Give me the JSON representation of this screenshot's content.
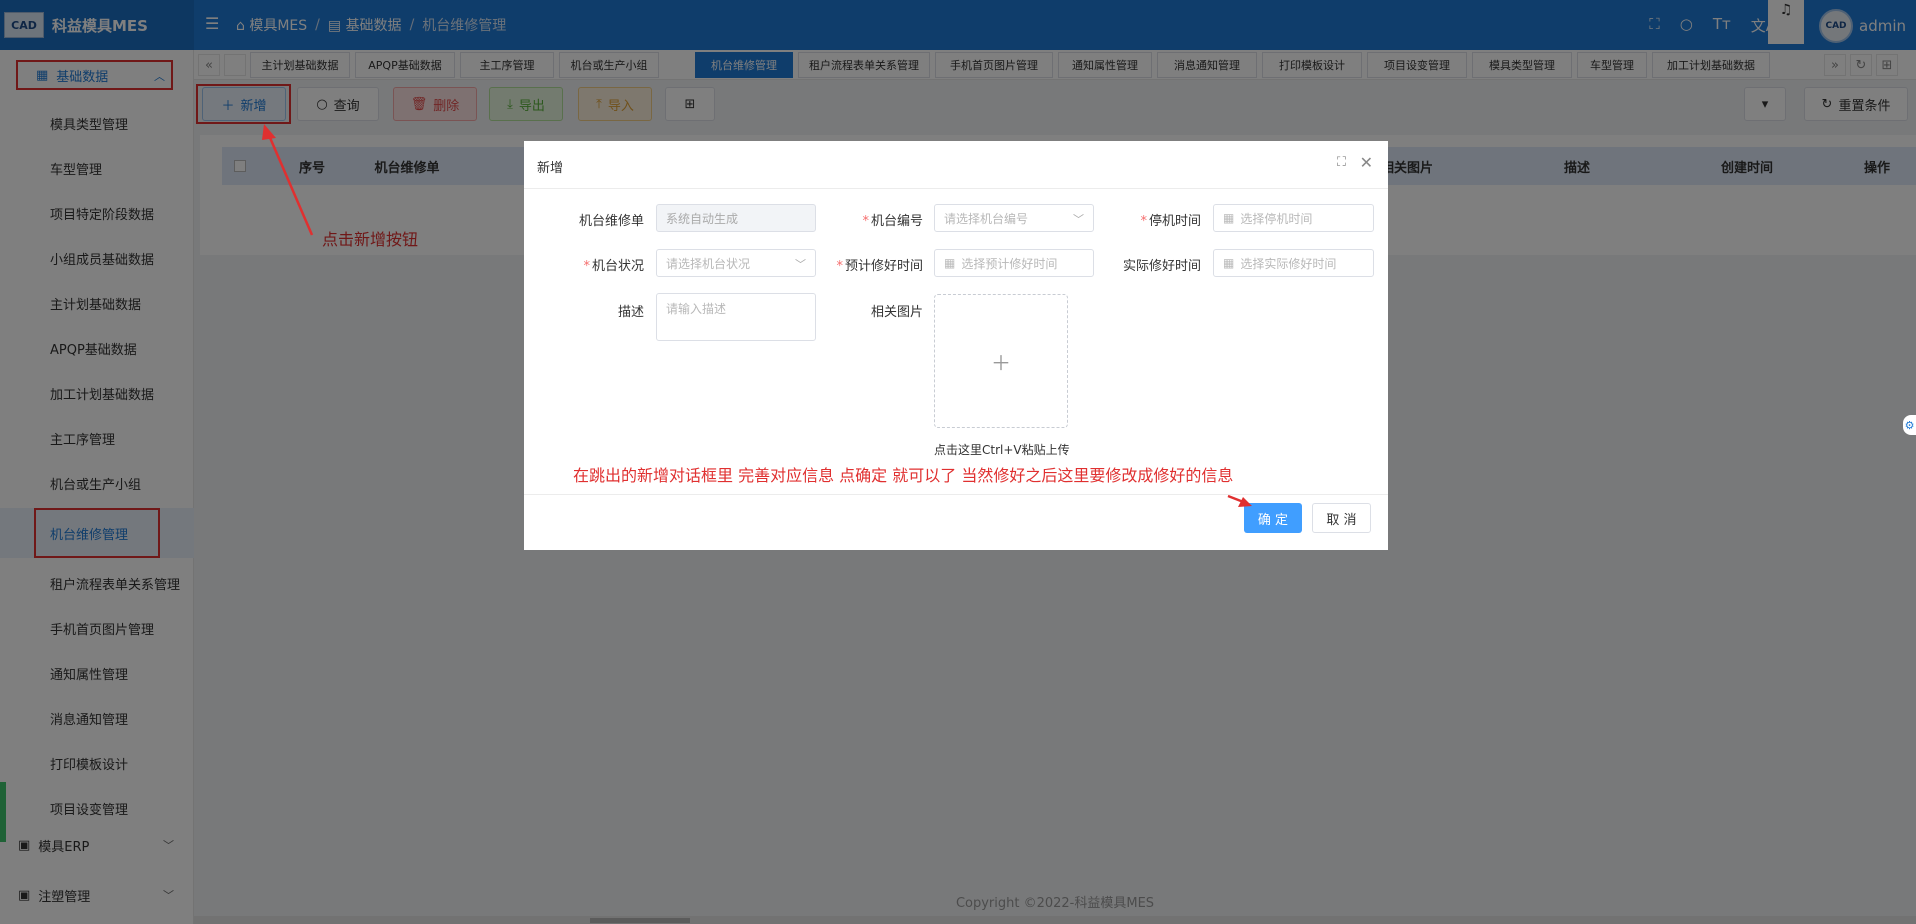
{
  "app": {
    "title": "科益模具MES",
    "logo_text": "CAD"
  },
  "header": {
    "breadcrumb": [
      "模具MES",
      "基础数据",
      "机台维修管理"
    ],
    "icons": [
      "fullscreen-icon",
      "search-icon",
      "font-size-icon",
      "translate-icon",
      "bell-icon"
    ],
    "user": "admin",
    "colors": {
      "bar": "#1f7ad6",
      "logo_bg": "#1b6fc3"
    }
  },
  "sidebar": {
    "group": "基础数据",
    "items": [
      "模具类型管理",
      "车型管理",
      "项目特定阶段数据",
      "小组成员基础数据",
      "主计划基础数据",
      "APQP基础数据",
      "加工计划基础数据",
      "主工序管理",
      "机台或生产小组",
      "机台维修管理",
      "租户流程表单关系管理",
      "手机首页图片管理",
      "通知属性管理",
      "消息通知管理",
      "打印模板设计",
      "项目设变管理"
    ],
    "active": "机台维修管理",
    "bottom": [
      "模具ERP",
      "注塑管理"
    ]
  },
  "tabs": [
    "主计划基础数据",
    "APQP基础数据",
    "主工序管理",
    "机台或生产小组",
    "机台维修管理",
    "租户流程表单关系管理",
    "手机首页图片管理",
    "通知属性管理",
    "消息通知管理",
    "打印模板设计",
    "项目设变管理",
    "模具类型管理",
    "车型管理",
    "加工计划基础数据"
  ],
  "tabs_active": "机台维修管理",
  "toolbar": {
    "add": "新增",
    "query": "查询",
    "delete": "删除",
    "export": "导出",
    "import": "导入",
    "reset": "重置条件"
  },
  "table": {
    "headers": [
      "序号",
      "机台维修单",
      "相关图片",
      "描述",
      "创建时间",
      "操作"
    ]
  },
  "annotations": {
    "click_add": "点击新增按钮",
    "modal_hint": "在跳出的新增对话框里 完善对应信息 点确定 就可以了 当然修好之后这里要修改成修好的信息"
  },
  "modal": {
    "title": "新增",
    "fields": {
      "order_label": "机台维修单",
      "order_placeholder": "系统自动生成",
      "machine_label": "机台编号",
      "machine_placeholder": "请选择机台编号",
      "stop_label": "停机时间",
      "stop_placeholder": "选择停机时间",
      "status_label": "机台状况",
      "status_placeholder": "请选择机台状况",
      "expected_label": "预计修好时间",
      "expected_placeholder": "选择预计修好时间",
      "actual_label": "实际修好时间",
      "actual_placeholder": "选择实际修好时间",
      "desc_label": "描述",
      "desc_placeholder": "请输入描述",
      "image_label": "相关图片",
      "upload_hint": "点击这里Ctrl+V粘贴上传"
    },
    "ok": "确 定",
    "cancel": "取 消"
  },
  "footer": "Copyright ©2022-科益模具MES"
}
